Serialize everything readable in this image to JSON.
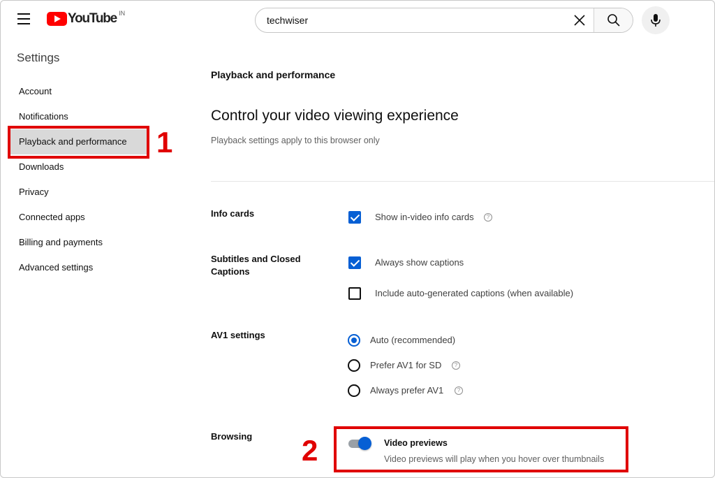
{
  "header": {
    "logo_text": "YouTube",
    "region": "IN",
    "search_value": "techwiser",
    "brand_color": "#ff0000"
  },
  "sidebar": {
    "title": "Settings",
    "items": [
      {
        "label": "Account"
      },
      {
        "label": "Notifications"
      },
      {
        "label": "Playback and performance",
        "active": true
      },
      {
        "label": "Downloads"
      },
      {
        "label": "Privacy"
      },
      {
        "label": "Connected apps"
      },
      {
        "label": "Billing and payments"
      },
      {
        "label": "Advanced settings"
      }
    ]
  },
  "annotations": {
    "step1": "1",
    "step2": "2",
    "color": "#e00000"
  },
  "main": {
    "section_heading": "Playback and performance",
    "title": "Control your video viewing experience",
    "subtitle": "Playback settings apply to this browser only",
    "info_cards": {
      "label": "Info cards",
      "options": [
        {
          "label": "Show in-video info cards",
          "checked": true
        }
      ]
    },
    "subtitles": {
      "label": "Subtitles and Closed Captions",
      "options": [
        {
          "label": "Always show captions",
          "checked": true
        },
        {
          "label": "Include auto-generated captions (when available)",
          "checked": false
        }
      ]
    },
    "av1": {
      "label": "AV1 settings",
      "options": [
        {
          "label": "Auto (recommended)",
          "selected": true
        },
        {
          "label": "Prefer AV1 for SD",
          "selected": false
        },
        {
          "label": "Always prefer AV1",
          "selected": false
        }
      ]
    },
    "browsing": {
      "label": "Browsing",
      "toggle_title": "Video previews",
      "toggle_desc": "Video previews will play when you hover over thumbnails",
      "toggle_on": true
    },
    "accent_color": "#065fd4",
    "help_glyph": "?"
  }
}
